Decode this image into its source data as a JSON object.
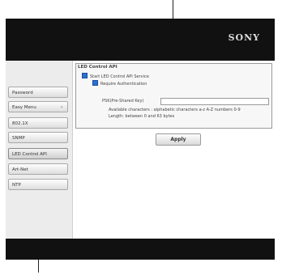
{
  "header": {
    "brand": "SONY"
  },
  "sidebar": {
    "items": [
      {
        "label": "Password"
      },
      {
        "label": "Easy Menu",
        "chevron": "»"
      },
      {
        "label": "802.1X"
      },
      {
        "label": "SNMP"
      },
      {
        "label": "LED Control API",
        "selected": true
      },
      {
        "label": "Art-Net"
      },
      {
        "label": "NTP"
      }
    ]
  },
  "panel": {
    "title": "LED Control API",
    "start_service_label": "Start LED Control API Service",
    "require_auth_label": "Require Authentication",
    "psk_label": "PSK(Pre-Shared Key)",
    "psk_value": "",
    "hint_line1": "Available characters : alphabetic characters a-z A-Z numbers 0-9",
    "hint_line2": "Length: between 0 and 63 bytes"
  },
  "apply_button": "Apply",
  "colors": {
    "checkbox": "#2d6fd0",
    "header_bg": "#111111"
  }
}
